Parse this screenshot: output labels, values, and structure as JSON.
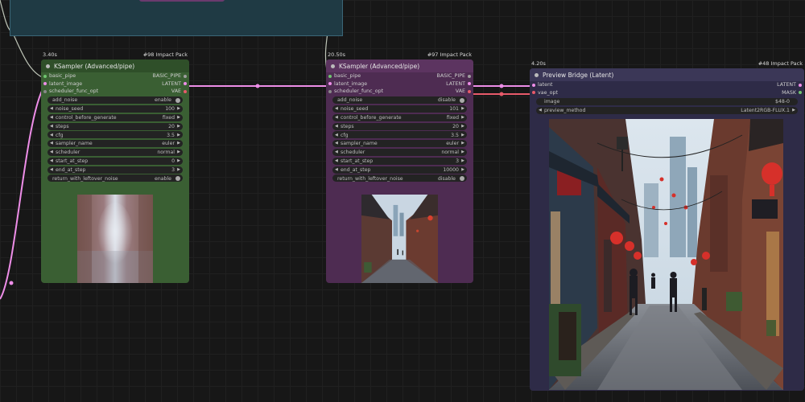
{
  "nodes": [
    {
      "id": "n1",
      "time": "3.40s",
      "pack": "#98 Impact Pack",
      "title": "KSampler (Advanced/pipe)",
      "io": [
        {
          "in": "basic_pipe",
          "out": "BASIC_PIPE"
        },
        {
          "in": "latent_image",
          "out": "LATENT"
        },
        {
          "in": "scheduler_func_opt",
          "out": "VAE"
        }
      ],
      "widgets": [
        {
          "label": "add_noise",
          "value": "enable",
          "toggle": true
        },
        {
          "label": "noise_seed",
          "value": "100"
        },
        {
          "label": "control_before_generate",
          "value": "fixed"
        },
        {
          "label": "steps",
          "value": "20"
        },
        {
          "label": "cfg",
          "value": "3.5"
        },
        {
          "label": "sampler_name",
          "value": "euler"
        },
        {
          "label": "scheduler",
          "value": "normal"
        },
        {
          "label": "start_at_step",
          "value": "0"
        },
        {
          "label": "end_at_step",
          "value": "3"
        },
        {
          "label": "return_with_leftover_noise",
          "value": "enable",
          "toggle": true
        }
      ]
    },
    {
      "id": "n2",
      "time": "20.50s",
      "pack": "#97 Impact Pack",
      "title": "KSampler (Advanced/pipe)",
      "io": [
        {
          "in": "basic_pipe",
          "out": "BASIC_PIPE"
        },
        {
          "in": "latent_image",
          "out": "LATENT"
        },
        {
          "in": "scheduler_func_opt",
          "out": "VAE"
        }
      ],
      "widgets": [
        {
          "label": "add_noise",
          "value": "disable",
          "toggle": true
        },
        {
          "label": "noise_seed",
          "value": "101"
        },
        {
          "label": "control_before_generate",
          "value": "fixed"
        },
        {
          "label": "steps",
          "value": "20"
        },
        {
          "label": "cfg",
          "value": "3.5"
        },
        {
          "label": "sampler_name",
          "value": "euler"
        },
        {
          "label": "scheduler",
          "value": "normal"
        },
        {
          "label": "start_at_step",
          "value": "3"
        },
        {
          "label": "end_at_step",
          "value": "10000"
        },
        {
          "label": "return_with_leftover_noise",
          "value": "disable",
          "toggle": true
        }
      ]
    },
    {
      "id": "n3",
      "time": "4.20s",
      "pack": "#48 Impact Pack",
      "title": "Preview Bridge (Latent)",
      "io": [
        {
          "in": "latent",
          "out": "LATENT"
        },
        {
          "in": "vae_opt",
          "out": "MASK"
        }
      ],
      "image_widget": {
        "label": "image",
        "value": "$48-0"
      },
      "widgets": [
        {
          "label": "preview_method",
          "value": "Latent2RGB-FLUX.1"
        }
      ]
    }
  ],
  "colors": {
    "sampler1_title": "#2f4f29",
    "sampler1_body": "#3a5f33",
    "sampler2_title": "#5c3460",
    "sampler2_body": "#4e2c52",
    "preview_title": "#3b3757",
    "preview_body": "#2e2b47",
    "wire_latent": "#ee8ee8",
    "wire_vae": "#e85a6a"
  }
}
